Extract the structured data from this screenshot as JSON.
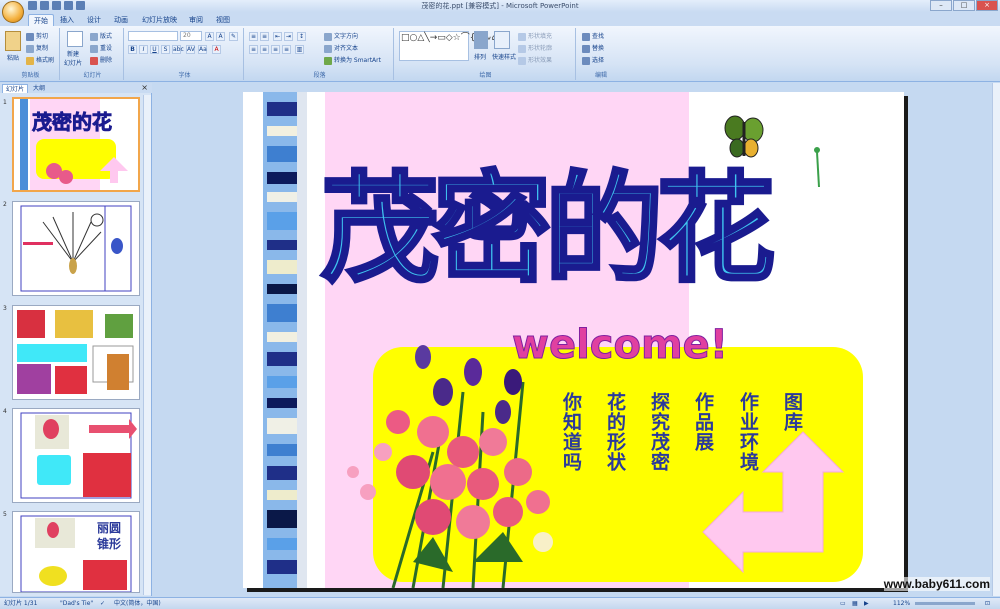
{
  "window": {
    "title": "茂密的花.ppt [兼容模式] - Microsoft PowerPoint"
  },
  "tabs": [
    "开始",
    "插入",
    "设计",
    "动画",
    "幻灯片放映",
    "审阅",
    "视图"
  ],
  "ribbon": {
    "clipboard": {
      "paste": "粘贴",
      "cut": "剪切",
      "copy": "复制",
      "format_painter": "格式刷",
      "label": "剪贴板"
    },
    "slides": {
      "new_slide": "新建\n幻灯片",
      "layout": "版式",
      "reset": "重设",
      "delete": "删除",
      "label": "幻灯片"
    },
    "font": {
      "size": "20",
      "label": "字体"
    },
    "paragraph": {
      "text_direction": "文字方向",
      "align_text": "对齐文本",
      "smartart": "转换为 SmartArt",
      "label": "段落"
    },
    "drawing": {
      "arrange": "排列",
      "quick_styles": "快速样式",
      "shape_fill": "形状填充",
      "shape_outline": "形状轮廓",
      "shape_effects": "形状效果",
      "label": "绘图"
    },
    "editing": {
      "find": "查找",
      "replace": "替换",
      "select": "选择",
      "label": "编辑"
    }
  },
  "panel": {
    "tab_slides": "幻灯片",
    "tab_outline": "大纲",
    "close": "×",
    "thumb_numbers": [
      "1",
      "2",
      "3",
      "4",
      "5"
    ]
  },
  "slide": {
    "title": "茂密的花",
    "welcome": "welcome!",
    "menu": [
      "图库",
      "作业环境",
      "作品展",
      "探究茂密",
      "花的形状",
      "你知道吗"
    ]
  },
  "status": {
    "slide_num": "幻灯片 1/31",
    "theme": "\"Dad's Tie\"",
    "language": "中文(简体，中国)",
    "zoom": "112%"
  },
  "watermark": "www.baby611.com",
  "colors": {
    "title_cyan": "#3fc4f0",
    "title_outline": "#1a1b8f",
    "pink_bg": "#ffd6f5",
    "yellow_box": "#ffff00",
    "menu_text": "#2b3a9a",
    "arrow_pink": "#ffc8ef"
  }
}
